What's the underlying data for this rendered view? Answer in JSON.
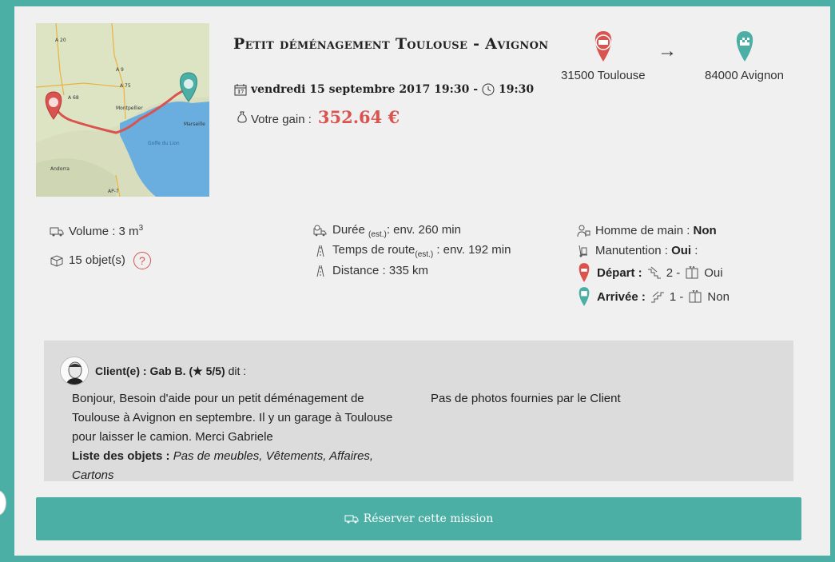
{
  "mission": {
    "title": "Petit déménagement Toulouse - Avignon",
    "date": "vendredi 15 septembre 2017 19:30 -",
    "time": "19:30",
    "gain_label": "Votre gain :",
    "gain_amount": "352.64 €"
  },
  "map": {
    "labels": [
      "A 20",
      "A 75",
      "A 68",
      "Montpellier",
      "Marseille",
      "Golfe du Lion",
      "Andorra",
      "AP-7",
      "A 9"
    ]
  },
  "route": {
    "from": "31500 Toulouse",
    "to": "84000 Avignon",
    "arrow": "→"
  },
  "details": {
    "volume_label": "Volume :",
    "volume_value": "3 m",
    "volume_unit_sup": "3",
    "objects": "15 objet(s)",
    "help": "?",
    "duration_label": "Durée",
    "duration_sub": "(est.)",
    "duration_value": ": env. 260 min",
    "road_label": "Temps de route",
    "road_sub": "(est.)",
    "road_value": ": env. 192 min",
    "distance": "Distance : 335 km",
    "helper_label": "Homme de main :",
    "helper_value": "Non",
    "handling_label": "Manutention :",
    "handling_value": "Oui",
    "handling_suffix": ":",
    "depart_label": "Départ :",
    "depart_floor": "2 -",
    "depart_elevator": "Oui",
    "arrival_label": "Arrivée :",
    "arrival_floor": "1 -",
    "arrival_elevator": "Non"
  },
  "client": {
    "header_prefix": "Client(e) : Gab B. (",
    "rating": "5/5)",
    "header_suffix": "dit :",
    "message": "Bonjour, Besoin d'aide pour un petit déménagement de Toulouse à Avignon en septembre. Il y un garage à Toulouse pour laisser le camion. Merci Gabriele",
    "list_label": "Liste des objets :",
    "list_value": "Pas de meubles, Vêtements, Affaires, Cartons",
    "photos": "Pas de photos fournies par le Client"
  },
  "action": {
    "reserve_label": "Réserver cette mission"
  },
  "colors": {
    "accent": "#4cafa5",
    "red": "#d9534f"
  }
}
